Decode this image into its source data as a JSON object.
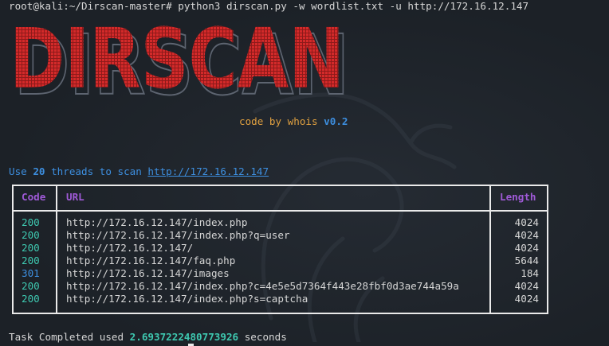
{
  "terminal": {
    "prompt": "root@kali:~/Dirscan-master#",
    "command": " python3 dirscan.py -w wordlist.txt -u http://172.16.12.147",
    "banner_text": "DIRSCAN",
    "credit_prefix": "code by whois ",
    "credit_version": "v0.2",
    "threads_prefix": "Use ",
    "threads_count": "20",
    "threads_middle": " threads to scan ",
    "target_url": "http://172.16.12.147",
    "table": {
      "headers": {
        "code": "Code",
        "url": "URL",
        "length": "Length"
      },
      "rows": [
        {
          "code": "200",
          "url": "http://172.16.12.147/index.php",
          "length": "4024"
        },
        {
          "code": "200",
          "url": "http://172.16.12.147/index.php?q=user",
          "length": "4024"
        },
        {
          "code": "200",
          "url": "http://172.16.12.147/",
          "length": "4024"
        },
        {
          "code": "200",
          "url": "http://172.16.12.147/faq.php",
          "length": "5644"
        },
        {
          "code": "301",
          "url": "http://172.16.12.147/images",
          "length": "184"
        },
        {
          "code": "200",
          "url": "http://172.16.12.147/index.php?c=4e5e5d7364f443e28fbf0d3ae744a59a",
          "length": "4024"
        },
        {
          "code": "200",
          "url": "http://172.16.12.147/index.php?s=captcha",
          "length": "4024"
        }
      ]
    },
    "completed_prefix": "Task Completed used ",
    "completed_time": "2.6937222480773926",
    "completed_suffix": " seconds"
  },
  "colors": {
    "background": "#1e2329",
    "banner_red": "#d42a2a",
    "accent_blue": "#3d8fe0",
    "accent_teal": "#3ec8b0",
    "header_purple": "#a05ad8",
    "credit_orange": "#e0a040"
  },
  "icons": {
    "watermark": "kali-dragon-icon"
  }
}
